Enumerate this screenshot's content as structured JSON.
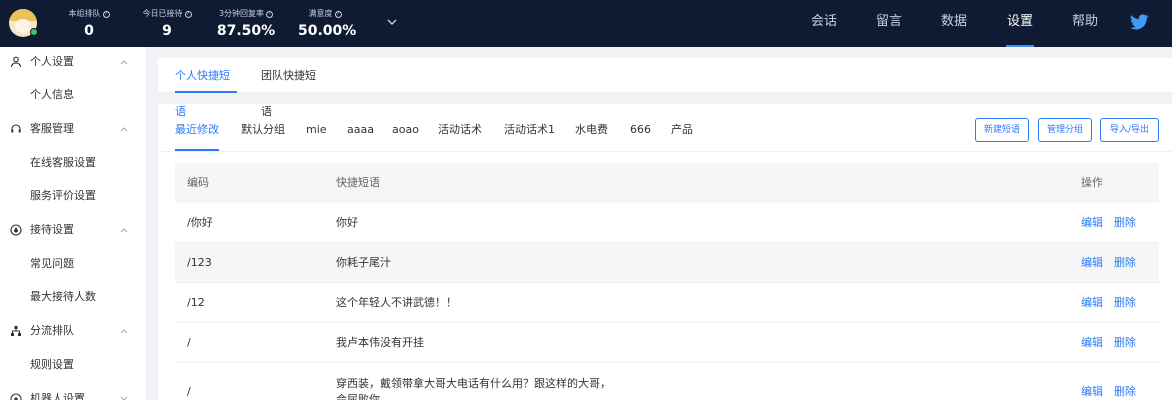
{
  "header": {
    "stats": [
      {
        "label": "本组排队",
        "value": "0"
      },
      {
        "label": "今日已接待",
        "value": "9"
      },
      {
        "label": "3分钟回复率",
        "value": "87.50%"
      },
      {
        "label": "满意度",
        "value": "50.00%"
      }
    ],
    "nav": [
      {
        "label": "会话"
      },
      {
        "label": "留言"
      },
      {
        "label": "数据"
      },
      {
        "label": "设置",
        "active": true
      },
      {
        "label": "帮助"
      }
    ]
  },
  "sidebar": {
    "groups": [
      {
        "label": "个人设置",
        "icon": "user-icon",
        "items": [
          "个人信息"
        ]
      },
      {
        "label": "客服管理",
        "icon": "headset-icon",
        "items": [
          "在线客服设置",
          "服务评价设置"
        ]
      },
      {
        "label": "接待设置",
        "icon": "drop-icon",
        "items": [
          "常见问题",
          "最大接待人数"
        ]
      },
      {
        "label": "分流排队",
        "icon": "org-icon",
        "items": [
          "规则设置"
        ]
      },
      {
        "label": "机器人设置",
        "icon": "robot-icon",
        "items": []
      }
    ]
  },
  "main": {
    "top_tabs": [
      "个人快捷短语",
      "团队快捷短语"
    ],
    "categories": [
      "最近修改",
      "默认分组",
      "mie",
      "aaaa",
      "aoao",
      "活动话术",
      "活动话术1",
      "水电费",
      "666",
      "产品"
    ],
    "buttons": {
      "new": "新建短语",
      "manage": "管理分组",
      "import_export": "导入/导出"
    },
    "table": {
      "headers": {
        "code": "编码",
        "text": "快捷短语",
        "ops": "操作"
      },
      "rows": [
        {
          "code": "/你好",
          "text": "你好"
        },
        {
          "code": "/123",
          "text": "你耗子尾汁"
        },
        {
          "code": "/12",
          "text": "这个年轻人不讲武德！！"
        },
        {
          "code": "/",
          "text": "我卢本伟没有开挂"
        },
        {
          "code": "/",
          "text": "穿西装，戴领带拿大哥大电话有什么用？跟这样的大哥，",
          "text2": "会尿败你"
        }
      ],
      "edit": "编辑",
      "delete": "删除"
    }
  },
  "colors": {
    "topbar": "#0f1a33",
    "accent": "#2d7bf4",
    "online": "#37c46b"
  }
}
